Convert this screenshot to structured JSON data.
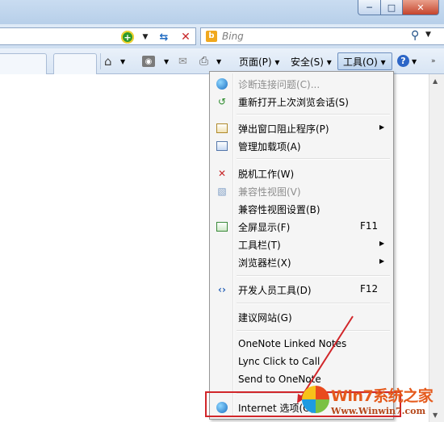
{
  "window": {
    "minimize_glyph": "─",
    "maximize_glyph": "□",
    "close_glyph": "✕"
  },
  "search": {
    "placeholder": "Bing"
  },
  "commandbar": {
    "page_label": "页面(P) ▾",
    "safety_label": "安全(S) ▾",
    "tools_label": "工具(O) ▾"
  },
  "tools_menu": {
    "items": [
      {
        "label": "诊断连接问题(C)...",
        "icon": "globe-icon",
        "disabled": true
      },
      {
        "label": "重新打开上次浏览会话(S)",
        "icon": "reopen-session-icon",
        "disabled": false
      },
      {
        "label": "弹出窗口阻止程序(P)",
        "icon": "popup-blocker-icon",
        "submenu": true
      },
      {
        "label": "管理加载项(A)",
        "icon": "addons-icon"
      },
      {
        "label": "脱机工作(W)",
        "icon": "offline-icon"
      },
      {
        "label": "兼容性视图(V)",
        "icon": "compat-view-icon",
        "disabled": true
      },
      {
        "label": "兼容性视图设置(B)"
      },
      {
        "label": "全屏显示(F)",
        "icon": "fullscreen-icon",
        "shortcut": "F11"
      },
      {
        "label": "工具栏(T)",
        "submenu": true
      },
      {
        "label": "浏览器栏(X)",
        "submenu": true
      },
      {
        "label": "开发人员工具(D)",
        "icon": "devtools-icon",
        "shortcut": "F12"
      },
      {
        "label": "建议网站(G)"
      },
      {
        "label": "OneNote Linked Notes"
      },
      {
        "label": "Lync Click to Call"
      },
      {
        "label": "Send to OneNote"
      },
      {
        "label": "Internet 选项(O)",
        "icon": "internet-options-icon"
      }
    ]
  },
  "watermark": {
    "title": "Win7系统之家",
    "url": "Www.Winwin7.com"
  },
  "colors": {
    "highlight_border": "#d1262a",
    "disabled_text": "#8e8e8e"
  }
}
